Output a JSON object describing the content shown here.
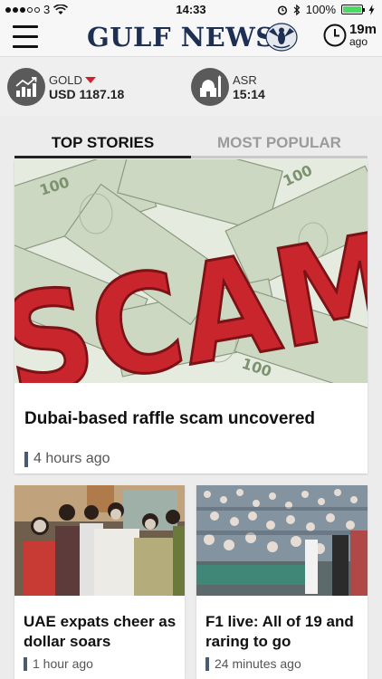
{
  "status_bar": {
    "carrier": "3",
    "time": "14:33",
    "battery": "100%"
  },
  "header": {
    "logo": "GULF NEWS",
    "updated_value": "19m",
    "updated_suffix": "ago"
  },
  "info_bar": {
    "gold": {
      "label": "GOLD",
      "value": "USD 1187.18",
      "trend": "down"
    },
    "prayer": {
      "label": "ASR",
      "value": "15:14"
    }
  },
  "tabs": [
    {
      "label": "TOP STORIES",
      "active": true
    },
    {
      "label": "MOST POPULAR",
      "active": false
    }
  ],
  "stories": [
    {
      "headline": "Dubai-based raffle scam uncovered",
      "time": "4 hours ago",
      "image_text": "SCAM"
    },
    {
      "headline": "UAE expats cheer as dollar soars",
      "time": "1 hour ago"
    },
    {
      "headline": "F1 live: All of 19 and raring to go",
      "time": "24 minutes ago"
    }
  ],
  "colors": {
    "logo": "#1d2f52",
    "trend_down": "#d61f2c",
    "battery": "#4cd964",
    "tab_active": "#111111",
    "tab_inactive": "#9b9b9b",
    "meta_bar": "#4a5b6f"
  }
}
